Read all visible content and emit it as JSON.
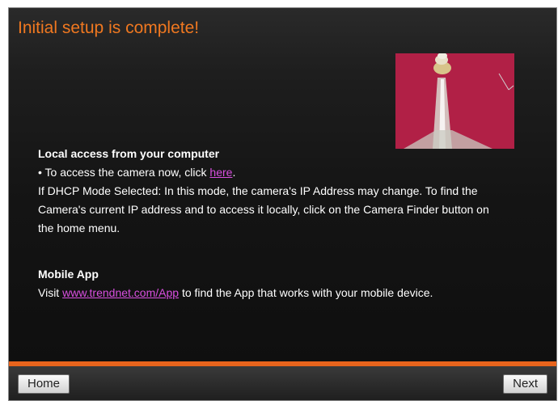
{
  "header": {
    "title": "Initial setup is complete!"
  },
  "camera_preview": {
    "label": "camera-preview-image"
  },
  "local_access": {
    "heading": "Local access from your computer",
    "access_prefix": "• To access the camera now, click ",
    "access_link": "here",
    "access_suffix": ".",
    "dhcp_line1": "If DHCP Mode Selected: In this mode, the camera's IP Address may change. To find the",
    "dhcp_line2": "Camera's current IP address and to access it locally, click on the Camera Finder button on",
    "dhcp_line3": "the home menu."
  },
  "mobile_app": {
    "heading": "Mobile App",
    "visit_prefix": "Visit ",
    "link": "www.trendnet.com/App",
    "visit_suffix": " to find the App that works with your mobile device."
  },
  "footer": {
    "home_label": "Home",
    "next_label": "Next"
  },
  "colors": {
    "title": "#f07820",
    "accent_bar": "#e8641c",
    "link": "#d94fe0",
    "preview_bg": "#b8234a"
  }
}
